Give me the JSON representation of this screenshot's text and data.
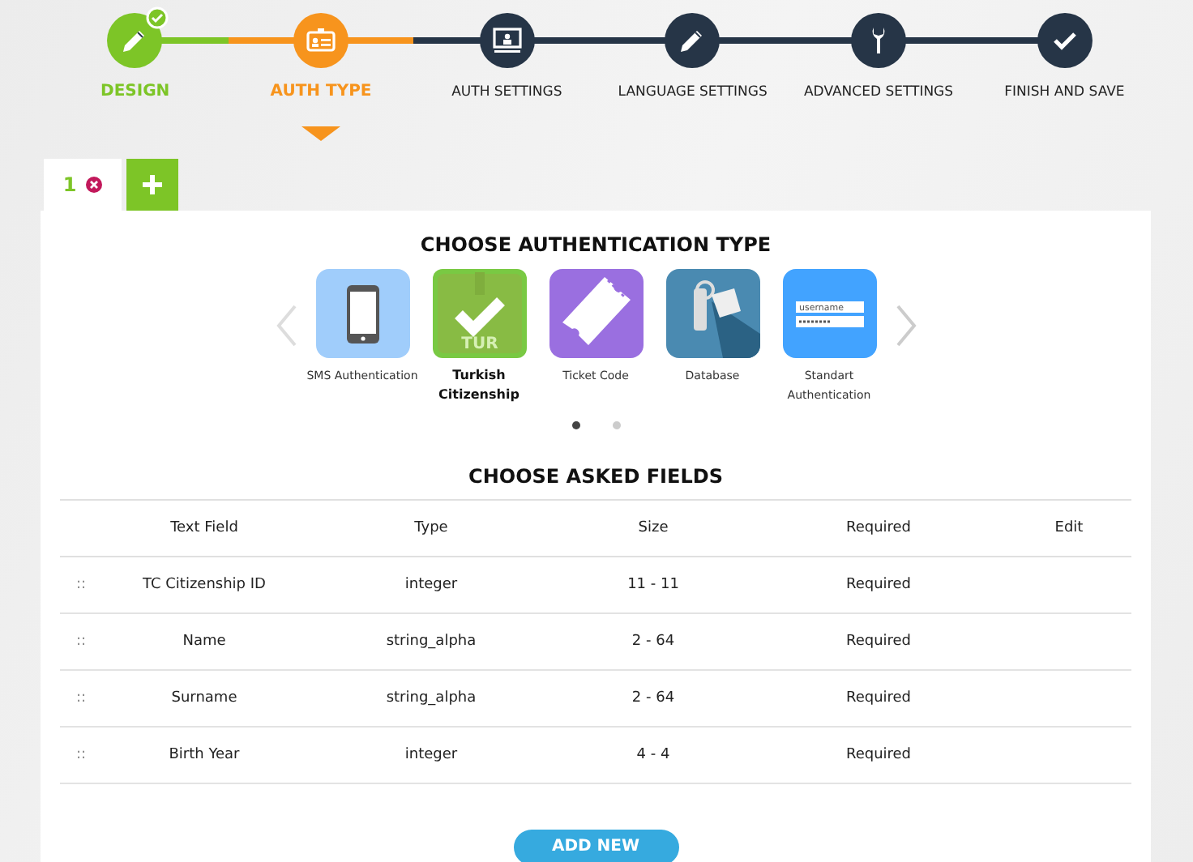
{
  "steps": [
    {
      "label": "DESIGN",
      "kind": "done"
    },
    {
      "label": "AUTH TYPE",
      "kind": "current"
    },
    {
      "label": "AUTH SETTINGS",
      "kind": "pending"
    },
    {
      "label": "LANGUAGE SETTINGS",
      "kind": "pending"
    },
    {
      "label": "ADVANCED SETTINGS",
      "kind": "pending"
    },
    {
      "label": "FINISH AND SAVE",
      "kind": "pending"
    }
  ],
  "tabs": [
    {
      "label": "1",
      "selected": true
    }
  ],
  "auth_section": {
    "title": "CHOOSE AUTHENTICATION TYPE",
    "types": [
      {
        "label": "SMS Authentication",
        "kind": "phone",
        "selected": false
      },
      {
        "label": "Turkish Citizenship",
        "kind": "citizen",
        "selected": true,
        "icon_text": "TUR"
      },
      {
        "label": "Ticket Code",
        "kind": "ticket",
        "selected": false
      },
      {
        "label": "Database",
        "kind": "database",
        "selected": false
      },
      {
        "label": "Standart Authentication",
        "kind": "login",
        "selected": false,
        "icon_text": "username"
      }
    ],
    "pages": [
      {
        "selected": true
      },
      {
        "selected": false
      }
    ]
  },
  "fields_section": {
    "title": "CHOOSE ASKED FIELDS",
    "columns": [
      "Text Field",
      "Type",
      "Size",
      "Required",
      "Edit"
    ],
    "rows": [
      {
        "handle": "::",
        "field": "TC Citizenship ID",
        "type": "integer",
        "size": "11 - 11",
        "required": "Required"
      },
      {
        "handle": "::",
        "field": "Name",
        "type": "string_alpha",
        "size": "2 - 64",
        "required": "Required"
      },
      {
        "handle": "::",
        "field": "Surname",
        "type": "string_alpha",
        "size": "2 - 64",
        "required": "Required"
      },
      {
        "handle": "::",
        "field": "Birth Year",
        "type": "integer",
        "size": "4 - 4",
        "required": "Required"
      }
    ],
    "add_button": "ADD NEW"
  }
}
